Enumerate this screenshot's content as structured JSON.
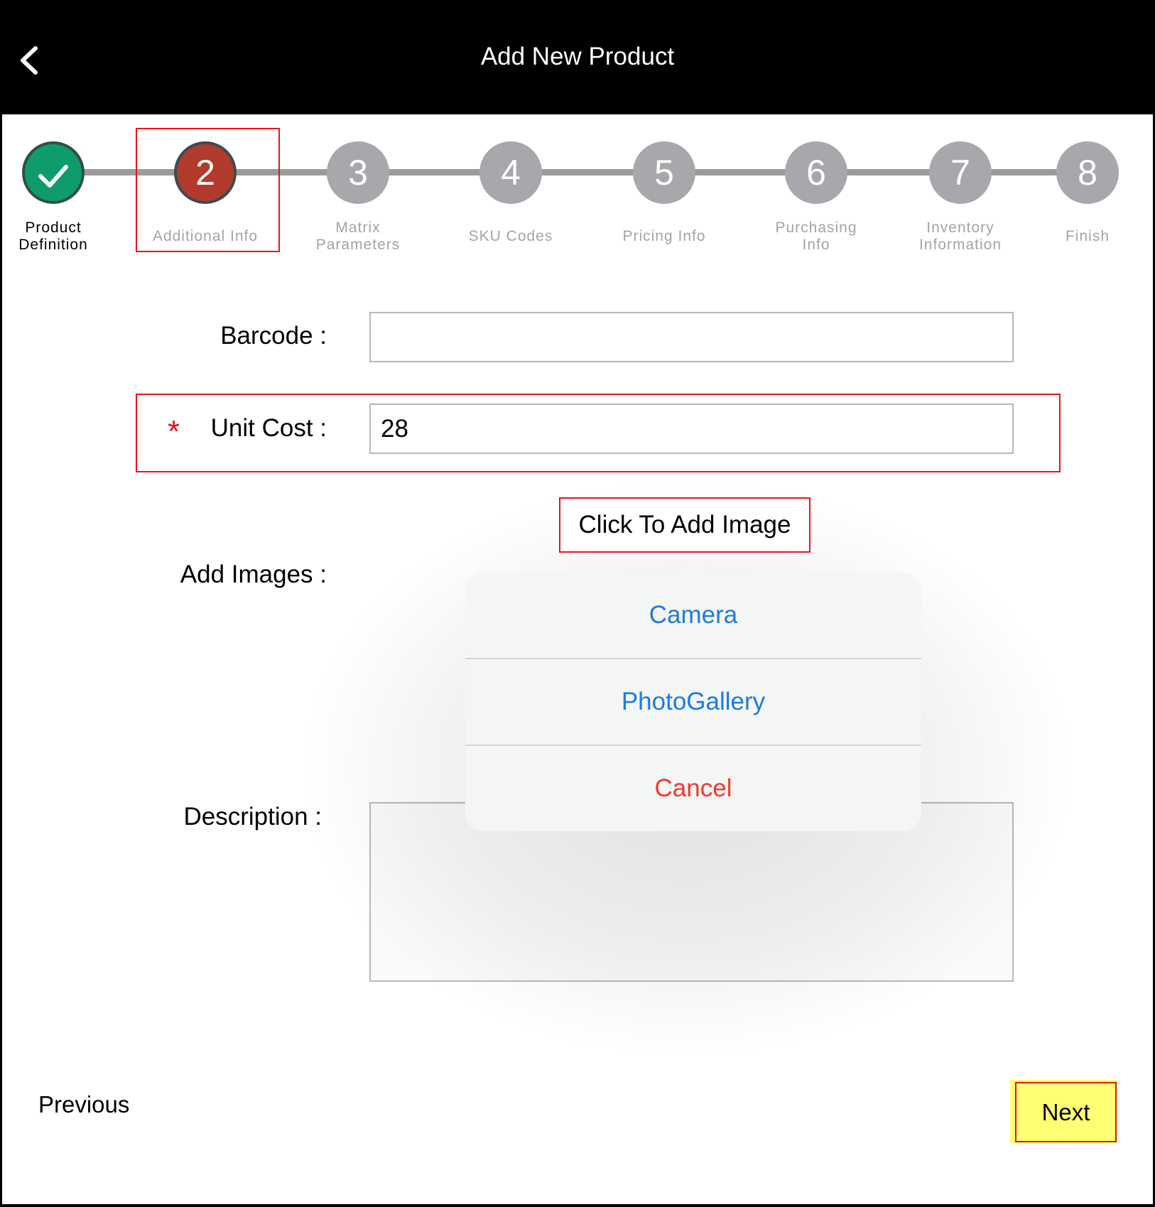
{
  "header": {
    "title": "Add New Product",
    "back_icon": "chevron-left-icon"
  },
  "stepper": {
    "steps": [
      {
        "number": "1",
        "label": "Product\nDefinition",
        "state": "done"
      },
      {
        "number": "2",
        "label": "Additional Info",
        "state": "current"
      },
      {
        "number": "3",
        "label": "Matrix\nParameters",
        "state": "pending"
      },
      {
        "number": "4",
        "label": "SKU Codes",
        "state": "pending"
      },
      {
        "number": "5",
        "label": "Pricing Info",
        "state": "pending"
      },
      {
        "number": "6",
        "label": "Purchasing\nInfo",
        "state": "pending"
      },
      {
        "number": "7",
        "label": "Inventory\nInformation",
        "state": "pending"
      },
      {
        "number": "8",
        "label": "Finish",
        "state": "pending"
      }
    ]
  },
  "form": {
    "barcode_label": "Barcode :",
    "barcode_value": "",
    "unit_cost_label": "Unit Cost :",
    "unit_cost_value": "28",
    "required_marker": "*",
    "add_images_label": "Add Images :",
    "add_image_button": "Click To Add Image",
    "description_label": "Description :",
    "description_value": ""
  },
  "popover": {
    "items": [
      {
        "label": "Camera",
        "style": "default"
      },
      {
        "label": "PhotoGallery",
        "style": "default"
      },
      {
        "label": "Cancel",
        "style": "destructive"
      }
    ]
  },
  "nav": {
    "previous_label": "Previous",
    "next_label": "Next"
  },
  "colors": {
    "done": "#0f9c6b",
    "current": "#b23a2c",
    "pending": "#a7a8ab",
    "highlight": "#e8141a",
    "link": "#1a7de0",
    "destructive": "#f03a30",
    "next_highlight": "#ffff73"
  }
}
